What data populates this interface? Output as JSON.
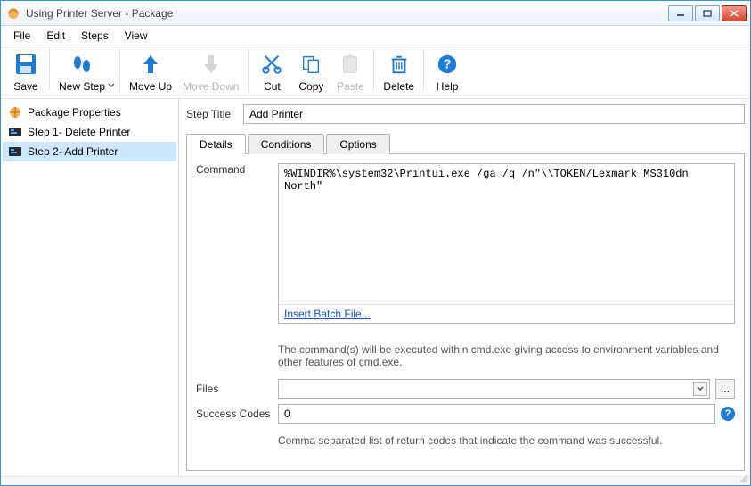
{
  "window": {
    "title": "Using Printer Server - Package"
  },
  "menu": {
    "file": "File",
    "edit": "Edit",
    "steps": "Steps",
    "view": "View"
  },
  "toolbar": {
    "save": "Save",
    "new_step": "New Step",
    "move_up": "Move Up",
    "move_down": "Move Down",
    "cut": "Cut",
    "copy": "Copy",
    "paste": "Paste",
    "delete": "Delete",
    "help": "Help"
  },
  "tree": {
    "root": "Package Properties",
    "items": [
      {
        "label": "Step 1- Delete Printer"
      },
      {
        "label": "Step 2- Add Printer"
      }
    ]
  },
  "step": {
    "title_label": "Step Title",
    "title_value": "Add Printer"
  },
  "tabs": {
    "details": "Details",
    "conditions": "Conditions",
    "options": "Options"
  },
  "details": {
    "command_label": "Command",
    "command_value": "%WINDIR%\\system32\\Printui.exe /ga /q /n\"\\\\TOKEN/Lexmark MS310dn North\"",
    "insert_link": "Insert Batch File...",
    "command_hint": "The command(s) will be executed within cmd.exe giving access to environment variables and other features of cmd.exe.",
    "files_label": "Files",
    "files_value": "",
    "browse_label": "...",
    "success_label": "Success Codes",
    "success_value": "0",
    "success_hint": "Comma separated list of return codes that indicate the command was successful."
  }
}
